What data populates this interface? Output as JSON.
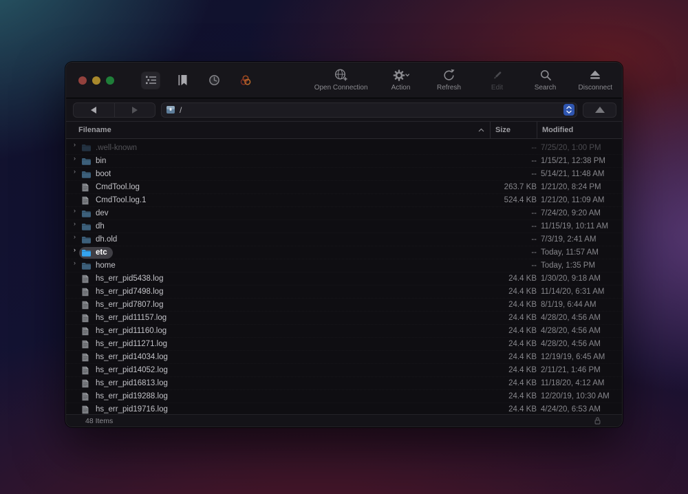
{
  "window": {
    "traffic_lights": [
      "close",
      "minimize",
      "zoom"
    ],
    "view_switcher": {
      "icons": [
        "list-view-icon",
        "bookmark-icon",
        "history-icon",
        "sync-rings-icon"
      ]
    },
    "toolbar": {
      "items": [
        {
          "label": "Open Connection",
          "icon": "globe-plus-icon",
          "enabled": true
        },
        {
          "label": "Action",
          "icon": "gear-icon",
          "has_chevron": true,
          "enabled": true
        },
        {
          "label": "Refresh",
          "icon": "refresh-icon",
          "enabled": true
        },
        {
          "label": "Edit",
          "icon": "pencil-icon",
          "enabled": false
        },
        {
          "label": "Search",
          "icon": "search-icon",
          "enabled": true
        },
        {
          "label": "Disconnect",
          "icon": "eject-icon",
          "enabled": true
        }
      ]
    },
    "pathbar": {
      "path": "/",
      "path_icon": "drive-icon",
      "back_enabled": true,
      "forward_enabled": false,
      "stepper_color": "#2e55b0"
    },
    "columns": {
      "filename": "Filename",
      "size": "Size",
      "modified": "Modified",
      "sort_column": "Filename",
      "sort_direction": "ascending"
    },
    "rows": [
      {
        "name": ".well-known",
        "kind": "folder",
        "size": "--",
        "modified": "7/25/20, 1:00 PM",
        "dimmed": true,
        "selected": false
      },
      {
        "name": "bin",
        "kind": "folder",
        "size": "--",
        "modified": "1/15/21, 12:38 PM",
        "dimmed": false,
        "selected": false
      },
      {
        "name": "boot",
        "kind": "folder",
        "size": "--",
        "modified": "5/14/21, 11:48 AM",
        "dimmed": false,
        "selected": false
      },
      {
        "name": "CmdTool.log",
        "kind": "file",
        "size": "263.7 KB",
        "modified": "1/21/20, 8:24 PM",
        "dimmed": false,
        "selected": false
      },
      {
        "name": "CmdTool.log.1",
        "kind": "file",
        "size": "524.4 KB",
        "modified": "1/21/20, 11:09 AM",
        "dimmed": false,
        "selected": false
      },
      {
        "name": "dev",
        "kind": "folder",
        "size": "--",
        "modified": "7/24/20, 9:20 AM",
        "dimmed": false,
        "selected": false
      },
      {
        "name": "dh",
        "kind": "folder",
        "size": "--",
        "modified": "11/15/19, 10:11 AM",
        "dimmed": false,
        "selected": false
      },
      {
        "name": "dh.old",
        "kind": "folder",
        "size": "--",
        "modified": "7/3/19, 2:41 AM",
        "dimmed": false,
        "selected": false
      },
      {
        "name": "etc",
        "kind": "folder",
        "size": "--",
        "modified": "Today, 11:57 AM",
        "dimmed": false,
        "selected": true
      },
      {
        "name": "home",
        "kind": "folder",
        "size": "--",
        "modified": "Today, 1:35 PM",
        "dimmed": false,
        "selected": false
      },
      {
        "name": "hs_err_pid5438.log",
        "kind": "file",
        "size": "24.4 KB",
        "modified": "1/30/20, 9:18 AM",
        "dimmed": false,
        "selected": false
      },
      {
        "name": "hs_err_pid7498.log",
        "kind": "file",
        "size": "24.4 KB",
        "modified": "11/14/20, 6:31 AM",
        "dimmed": false,
        "selected": false
      },
      {
        "name": "hs_err_pid7807.log",
        "kind": "file",
        "size": "24.4 KB",
        "modified": "8/1/19, 6:44 AM",
        "dimmed": false,
        "selected": false
      },
      {
        "name": "hs_err_pid11157.log",
        "kind": "file",
        "size": "24.4 KB",
        "modified": "4/28/20, 4:56 AM",
        "dimmed": false,
        "selected": false
      },
      {
        "name": "hs_err_pid11160.log",
        "kind": "file",
        "size": "24.4 KB",
        "modified": "4/28/20, 4:56 AM",
        "dimmed": false,
        "selected": false
      },
      {
        "name": "hs_err_pid11271.log",
        "kind": "file",
        "size": "24.4 KB",
        "modified": "4/28/20, 4:56 AM",
        "dimmed": false,
        "selected": false
      },
      {
        "name": "hs_err_pid14034.log",
        "kind": "file",
        "size": "24.4 KB",
        "modified": "12/19/19, 6:45 AM",
        "dimmed": false,
        "selected": false
      },
      {
        "name": "hs_err_pid14052.log",
        "kind": "file",
        "size": "24.4 KB",
        "modified": "2/11/21, 1:46 PM",
        "dimmed": false,
        "selected": false
      },
      {
        "name": "hs_err_pid16813.log",
        "kind": "file",
        "size": "24.4 KB",
        "modified": "11/18/20, 4:12 AM",
        "dimmed": false,
        "selected": false
      },
      {
        "name": "hs_err_pid19288.log",
        "kind": "file",
        "size": "24.4 KB",
        "modified": "12/20/19, 10:30 AM",
        "dimmed": false,
        "selected": false
      },
      {
        "name": "hs_err_pid19716.log",
        "kind": "file",
        "size": "24.4 KB",
        "modified": "4/24/20, 6:53 AM",
        "dimmed": false,
        "selected": false
      }
    ],
    "status": {
      "items_count": "48 Items",
      "lock_icon": "lock-icon"
    },
    "colors": {
      "accent_stepper": "#2e55b0",
      "folder_normal": "#3c5f7a",
      "folder_selected": "#35a4ef",
      "selection_pill": "#403f45",
      "window_bg": "#0f0e12"
    }
  }
}
